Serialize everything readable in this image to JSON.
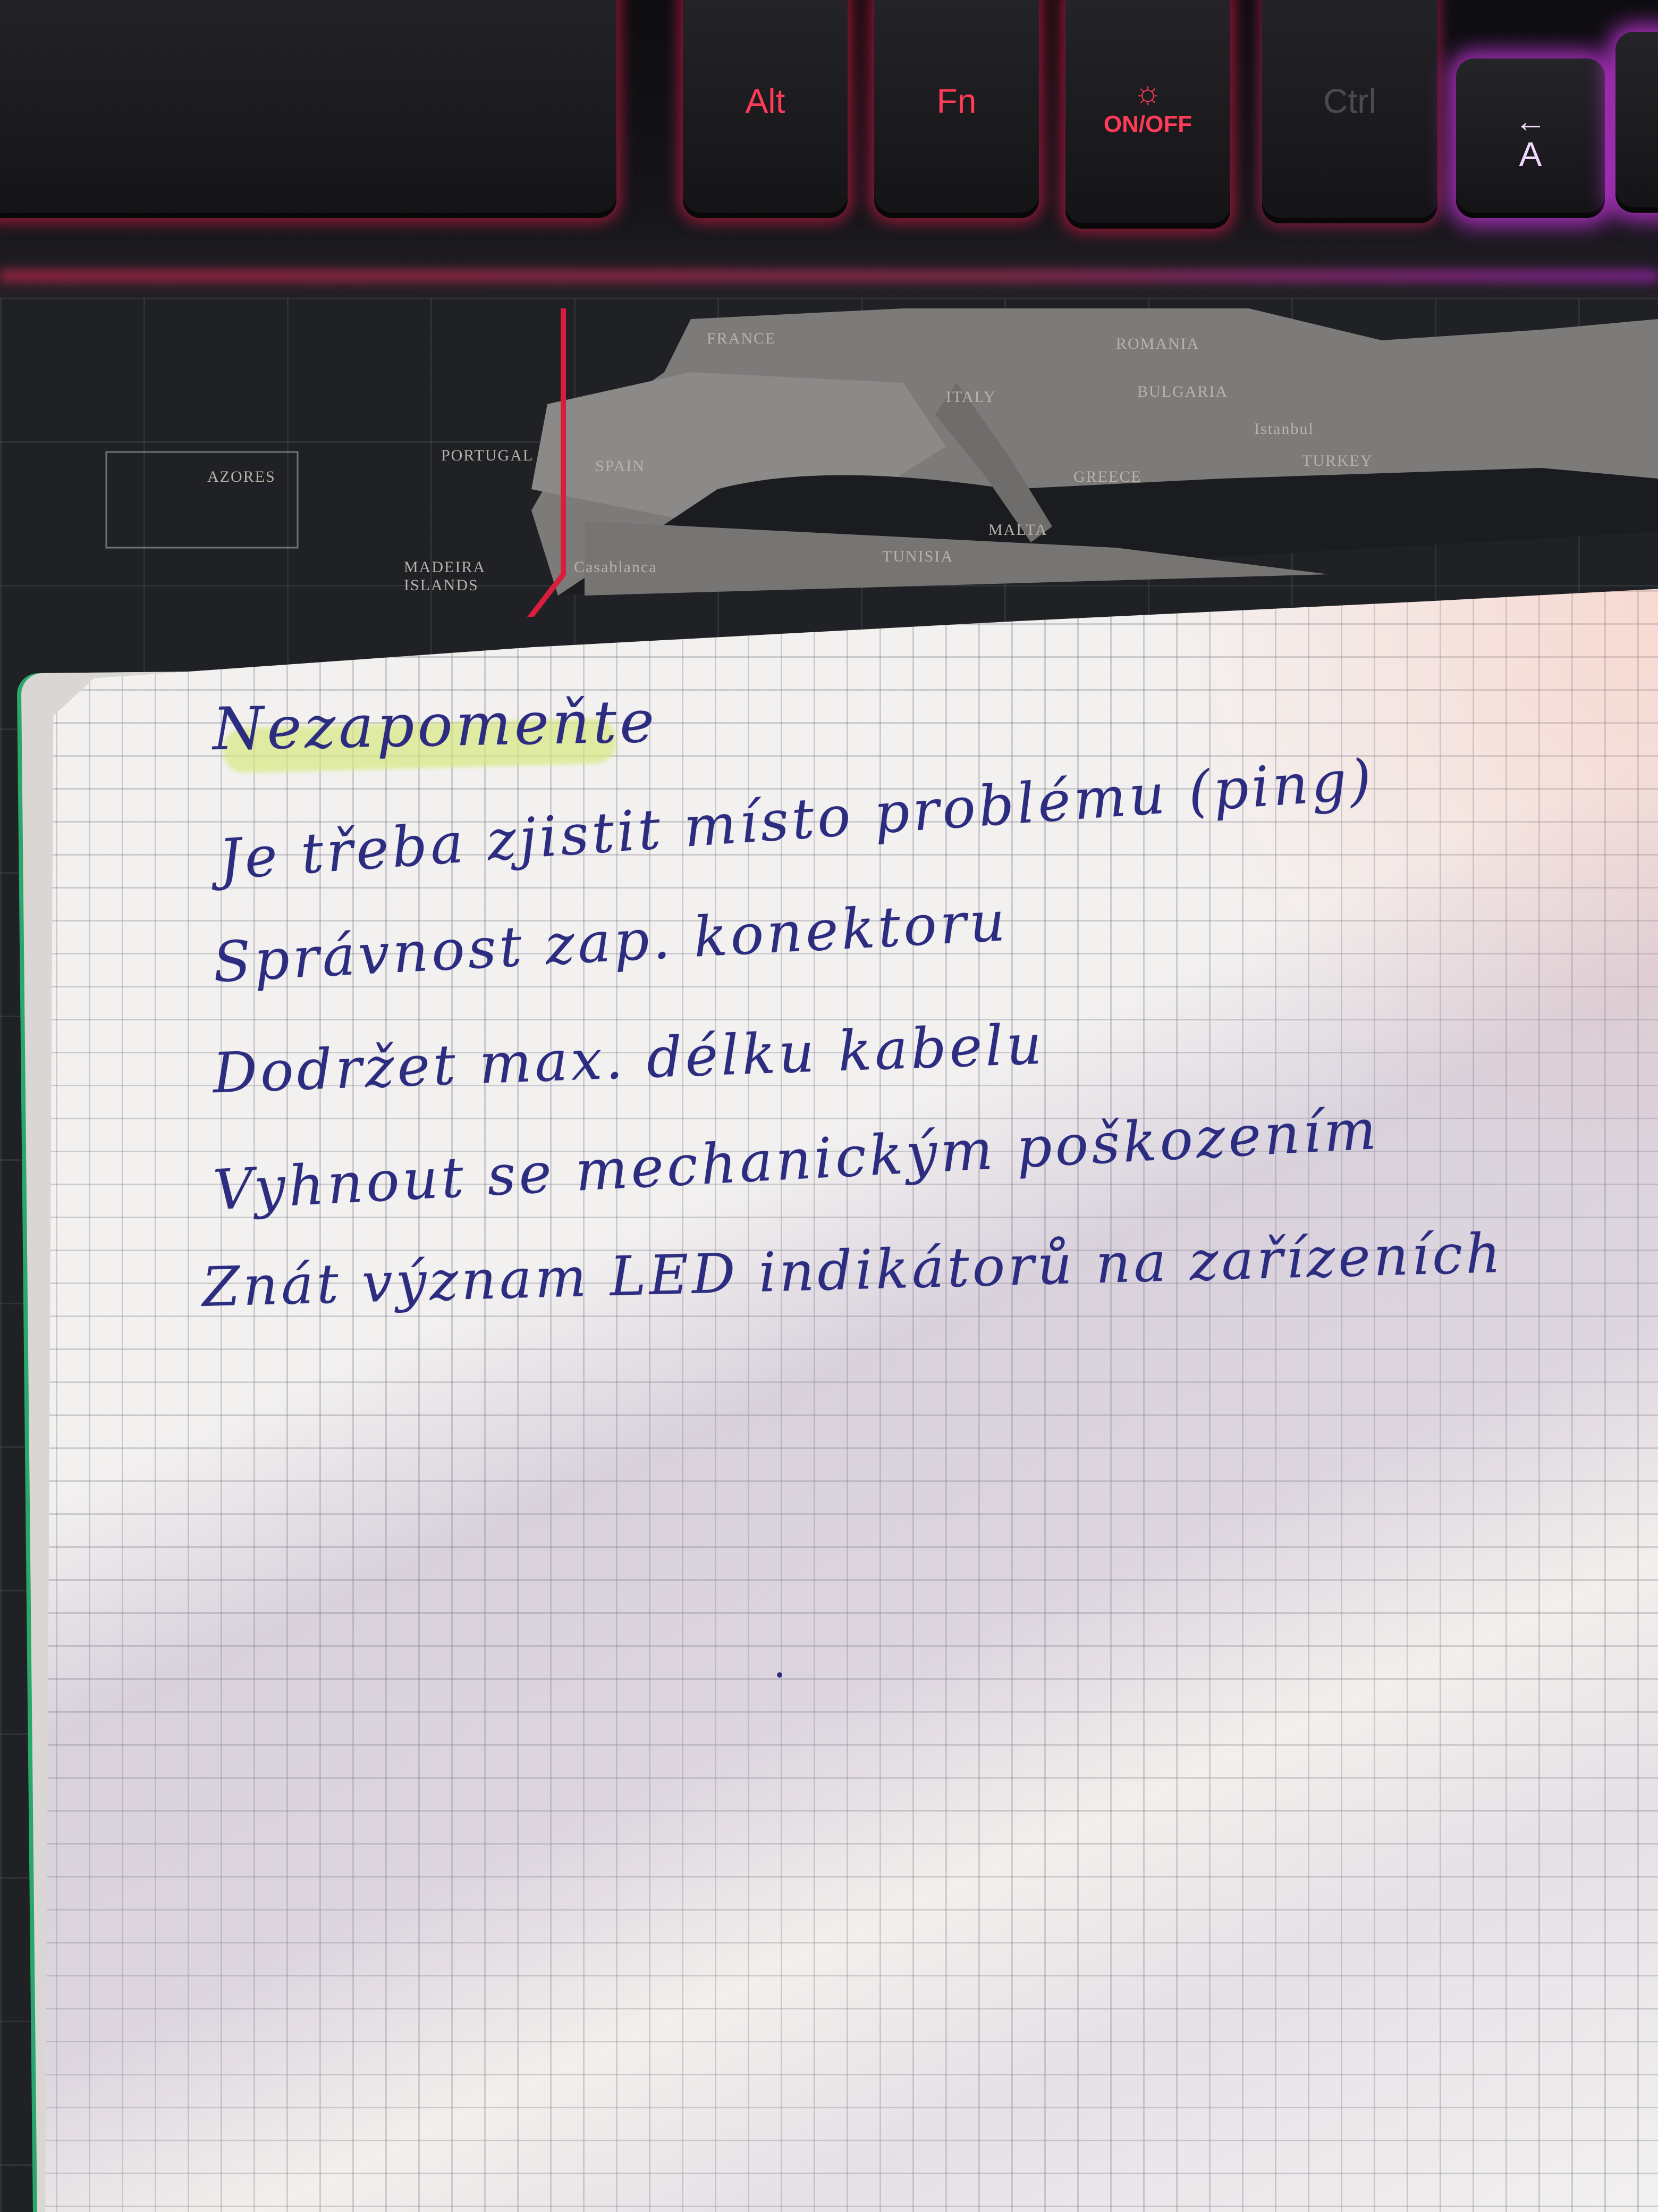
{
  "keyboard": {
    "keys": [
      {
        "id": "alt",
        "label": "Alt"
      },
      {
        "id": "fn",
        "label": "Fn"
      },
      {
        "id": "onoff",
        "label": "ON/OFF",
        "icon": "sun-icon"
      },
      {
        "id": "ctrl",
        "label": "Ctrl"
      },
      {
        "id": "arrow",
        "label": "A",
        "icon": "arrow-left-icon"
      }
    ],
    "glow_colors": {
      "red": "#ff2a55",
      "purple": "#e23cff"
    }
  },
  "map": {
    "labels": [
      "FRANCE",
      "ROMANIA",
      "BULGARIA",
      "ITALY",
      "SPAIN",
      "PORTUGAL",
      "GREECE",
      "TURKEY",
      "MALTA",
      "TUNISIA",
      "AZORES",
      "MADEIRA ISLANDS",
      "Casablanca",
      "Istanbul"
    ]
  },
  "notebook": {
    "heading": "Nezapomeňte",
    "lines": [
      "Je třeba zjistit místo problému (ping)",
      "Správnost zap. konektoru",
      "Dodržet max. délku kabelu",
      "Vyhnout se mechanickým poškozením",
      "Znát význam LED indikátorů na zařízeních"
    ],
    "ink_color": "#2c2c80",
    "highlight_color": "#d6e878",
    "binding_color": "#2aa86c"
  }
}
